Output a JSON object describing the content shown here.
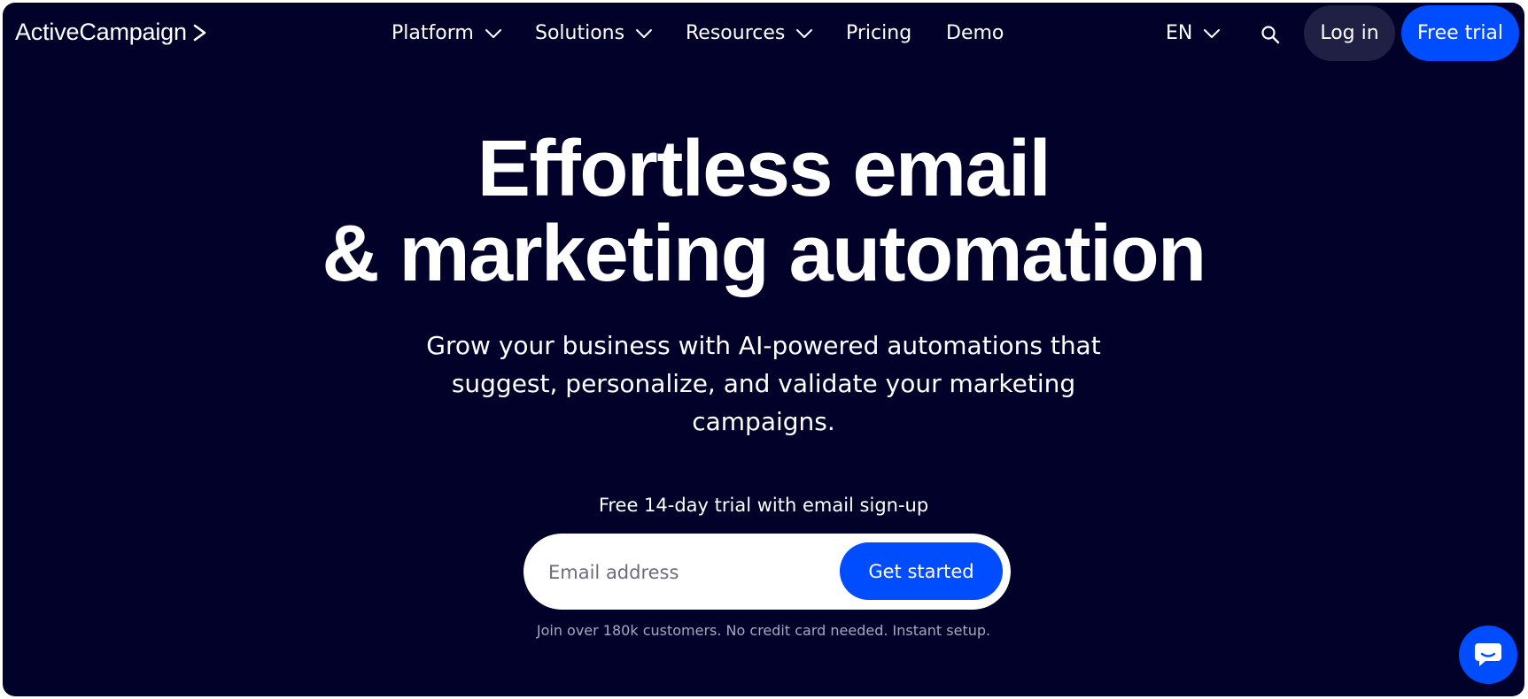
{
  "header": {
    "logo_text": "ActiveCampaign",
    "nav": [
      {
        "label": "Platform",
        "has_dropdown": true
      },
      {
        "label": "Solutions",
        "has_dropdown": true
      },
      {
        "label": "Resources",
        "has_dropdown": true
      },
      {
        "label": "Pricing",
        "has_dropdown": false
      },
      {
        "label": "Demo",
        "has_dropdown": false
      }
    ],
    "language": "EN",
    "login_label": "Log in",
    "trial_label": "Free trial"
  },
  "hero": {
    "title_line1": "Effortless email",
    "title_line2": "& marketing automation",
    "subtitle": "Grow your business with AI-powered automations that suggest, personalize, and validate your marketing campaigns.",
    "trial_note": "Free 14-day trial with email sign-up",
    "email_placeholder": "Email address",
    "cta_label": "Get started",
    "fine_print": "Join over 180k customers. No credit card needed. Instant setup."
  },
  "icons": {
    "logo": "chevron-right-icon",
    "dropdown": "chevron-down-icon",
    "search": "search-icon",
    "chat": "chat-bubble-icon"
  },
  "colors": {
    "background": "#01012a",
    "accent": "#004cff",
    "login_bg": "#1f2044",
    "fine_print": "#a7a8c0"
  }
}
